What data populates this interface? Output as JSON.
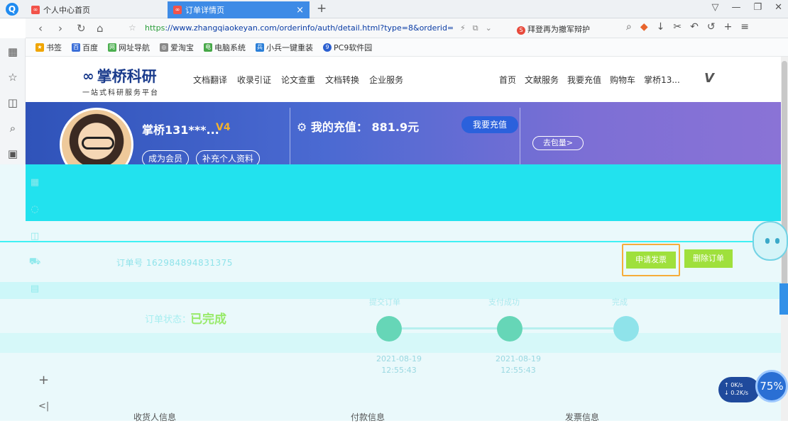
{
  "browser": {
    "tabs": [
      {
        "label": "个人中心首页",
        "active": false
      },
      {
        "label": "订单详情页",
        "active": true
      }
    ],
    "url_scheme": "https",
    "url_rest": "://www.zhangqiaokeyan.com/orderinfo/auth/detail.html?type=8&orderid=",
    "news_text": "拜登再为撤军辩护",
    "bookmarks": [
      "书签",
      "百度",
      "网址导航",
      "爱淘宝",
      "电脑系统",
      "小兵一键重装",
      "PC9软件园"
    ]
  },
  "site": {
    "logo_main": "掌桥科研",
    "logo_sub": "一站式科研服务平台",
    "nav": [
      "文档翻译",
      "收录引证",
      "论文查重",
      "文档转换",
      "企业服务"
    ],
    "right_nav": [
      "首页",
      "文献服务",
      "我要充值",
      "购物车",
      "掌桥13..."
    ]
  },
  "user": {
    "name": "掌桥131***...",
    "vip": "V4",
    "become_member": "成为会员",
    "complete_profile": "补充个人资料",
    "recharge_label": "我的充值：",
    "recharge_amount": "881.9元",
    "recharge_button": "我要充值",
    "package_button": "去包量>"
  },
  "order": {
    "order_no_label": "订单号",
    "order_no": "162984894831375",
    "apply_invoice": "申请发票",
    "delete_order": "删除订单",
    "status_label": "订单状态：",
    "status_value": "已完成",
    "steps": [
      {
        "title": "提交订单",
        "date": "2021-08-19",
        "time": "12:55:43"
      },
      {
        "title": "支付成功",
        "date": "2021-08-19",
        "time": "12:55:43"
      },
      {
        "title": "完成",
        "date": "",
        "time": ""
      }
    ]
  },
  "bottom": {
    "receiver_info": "收货人信息",
    "payment_info": "付款信息",
    "invoice_info": "发票信息"
  },
  "speed": {
    "up": "0K/s",
    "down": "0.2K/s",
    "percent": "75%"
  },
  "colors": {
    "tab_active": "#3e8be6",
    "banner_start": "#2f53b9",
    "banner_end": "#8a73d6",
    "overlay": "#22e2ee",
    "highlight": "#f5ad3a"
  }
}
